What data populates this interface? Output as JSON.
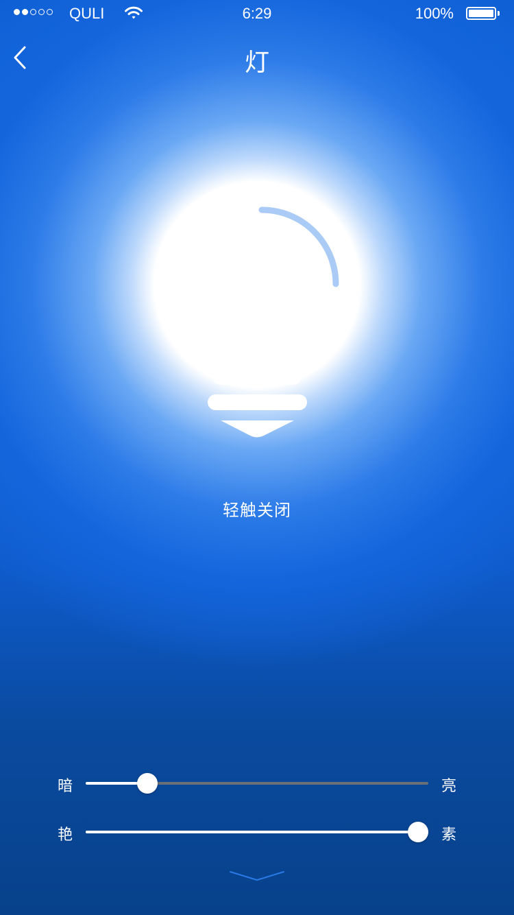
{
  "status_bar": {
    "carrier": "QULI",
    "time": "6:29",
    "battery_percent": "100%",
    "signal_strength": 2,
    "signal_max": 5
  },
  "nav": {
    "title": "灯",
    "back_icon": "chevron-left-icon"
  },
  "bulb": {
    "icon": "light-bulb-icon",
    "state": "on"
  },
  "tap_label": "轻触关闭",
  "sliders": {
    "brightness": {
      "left_label": "暗",
      "right_label": "亮",
      "value": 0.18
    },
    "saturation": {
      "left_label": "艳",
      "right_label": "素",
      "value": 0.97
    }
  },
  "expand_icon": "chevron-down-icon",
  "colors": {
    "accent": "#1466dc",
    "background_dark": "#07418b",
    "track_inactive": "#6b6f78",
    "foreground": "#ffffff"
  }
}
